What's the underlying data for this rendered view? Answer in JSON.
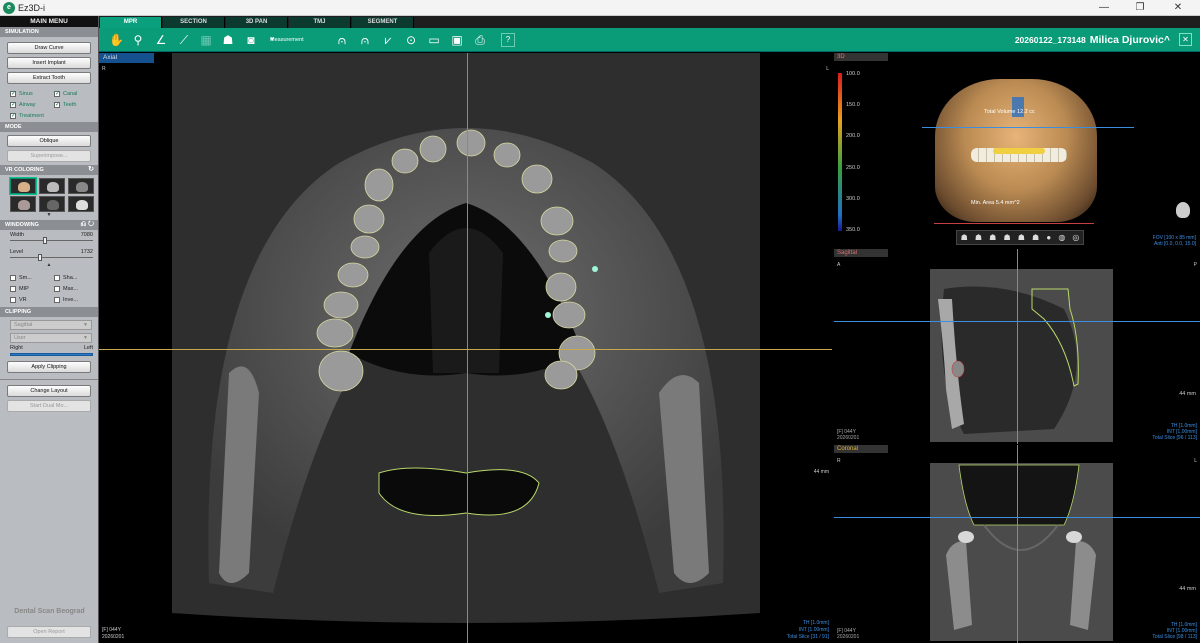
{
  "window": {
    "title": "Ez3D-i",
    "minimize": "—",
    "maximize": "❐",
    "close": "✕"
  },
  "sidebar": {
    "main_menu": "MAIN MENU",
    "simulation": {
      "header": "SIMULATION",
      "buttons": [
        "Draw Curve",
        "Insert Implant",
        "Extract Tooth"
      ],
      "checks": [
        {
          "label": "Sinus",
          "checked": true
        },
        {
          "label": "Canal",
          "checked": true
        },
        {
          "label": "Airway",
          "checked": true
        },
        {
          "label": "Teeth",
          "checked": true
        },
        {
          "label": "Treatment",
          "checked": true
        }
      ]
    },
    "mode": {
      "header": "MODE",
      "oblique": "Oblique",
      "superimpose": "Superimpose..."
    },
    "vr_coloring": {
      "header": "VR COLORING",
      "refresh_icon": "↻",
      "expand": "▼"
    },
    "windowing": {
      "header": "WINDOWING",
      "header_icons": "⎌ ↻",
      "width_label": "Width",
      "width_value": "7080",
      "level_label": "Level",
      "level_value": "1732",
      "width_fraction": 0.45,
      "level_fraction": 0.38,
      "collapse": "▲",
      "checks": [
        {
          "label": "Sm...",
          "checked": false
        },
        {
          "label": "Sha...",
          "checked": false
        },
        {
          "label": "MIP",
          "checked": false
        },
        {
          "label": "Max...",
          "checked": false
        },
        {
          "label": "VR",
          "checked": false
        },
        {
          "label": "Inve...",
          "checked": false
        }
      ]
    },
    "clipping": {
      "header": "CLIPPING",
      "dropdown1": "Sagittal",
      "dropdown2": "User",
      "right": "Right",
      "left": "Left",
      "apply": "Apply Clipping"
    },
    "change_layout": "Change Layout",
    "start_dual": "Start Dual Mo...",
    "brand": "Dental Scan Beograd",
    "open_report": "Open Report"
  },
  "tabs": [
    "MPR",
    "SECTION",
    "3D PAN",
    "TMJ",
    "SEGMENT"
  ],
  "active_tab": "MPR",
  "toolbar": {
    "measurement_label": "Measurement",
    "patient_id": "20260122_173148",
    "patient_name": "Milica Djurovic^",
    "close_icon": "✕"
  },
  "axial": {
    "label": "Axial",
    "corner_r": "R",
    "corner_l": "L",
    "scale": "44 mm",
    "info_left_1": "[F] 044Y",
    "info_left_2": "20260201",
    "info_right_1": "TH [1.0mm]",
    "info_right_2": "INT [1.00mm]",
    "info_right_3": "Total Slice [31 / 91]"
  },
  "view3d": {
    "label": "3D",
    "colorbar_values": [
      "100.0",
      "150.0",
      "200.0",
      "250.0",
      "300.0",
      "350.0"
    ],
    "total_volume": "Total Volume 12.2 cc",
    "min_area": "Min. Area 5.4 mm^2",
    "fov_1": "FOV [100 x 85 mm]",
    "fov_2": "Anti [0.0, 0.0, 15.0]"
  },
  "sagittal": {
    "label": "Sagittal",
    "corner_a": "A",
    "corner_p": "P",
    "scale": "44 mm",
    "info_left_1": "[F] 044Y",
    "info_left_2": "20260201",
    "info_right_1": "TH [1.0mm]",
    "info_right_2": "INT [1.00mm]",
    "info_right_3": "Total Slice [96 / 113]"
  },
  "coronal": {
    "label": "Coronal",
    "corner_r": "R",
    "corner_l": "L",
    "scale": "44 mm",
    "info_left_1": "[F] 044Y",
    "info_left_2": "20260201",
    "info_right_1": "TH [1.0mm]",
    "info_right_2": "INT [1.00mm]",
    "info_right_3": "Total Slice [98 / 113]"
  }
}
